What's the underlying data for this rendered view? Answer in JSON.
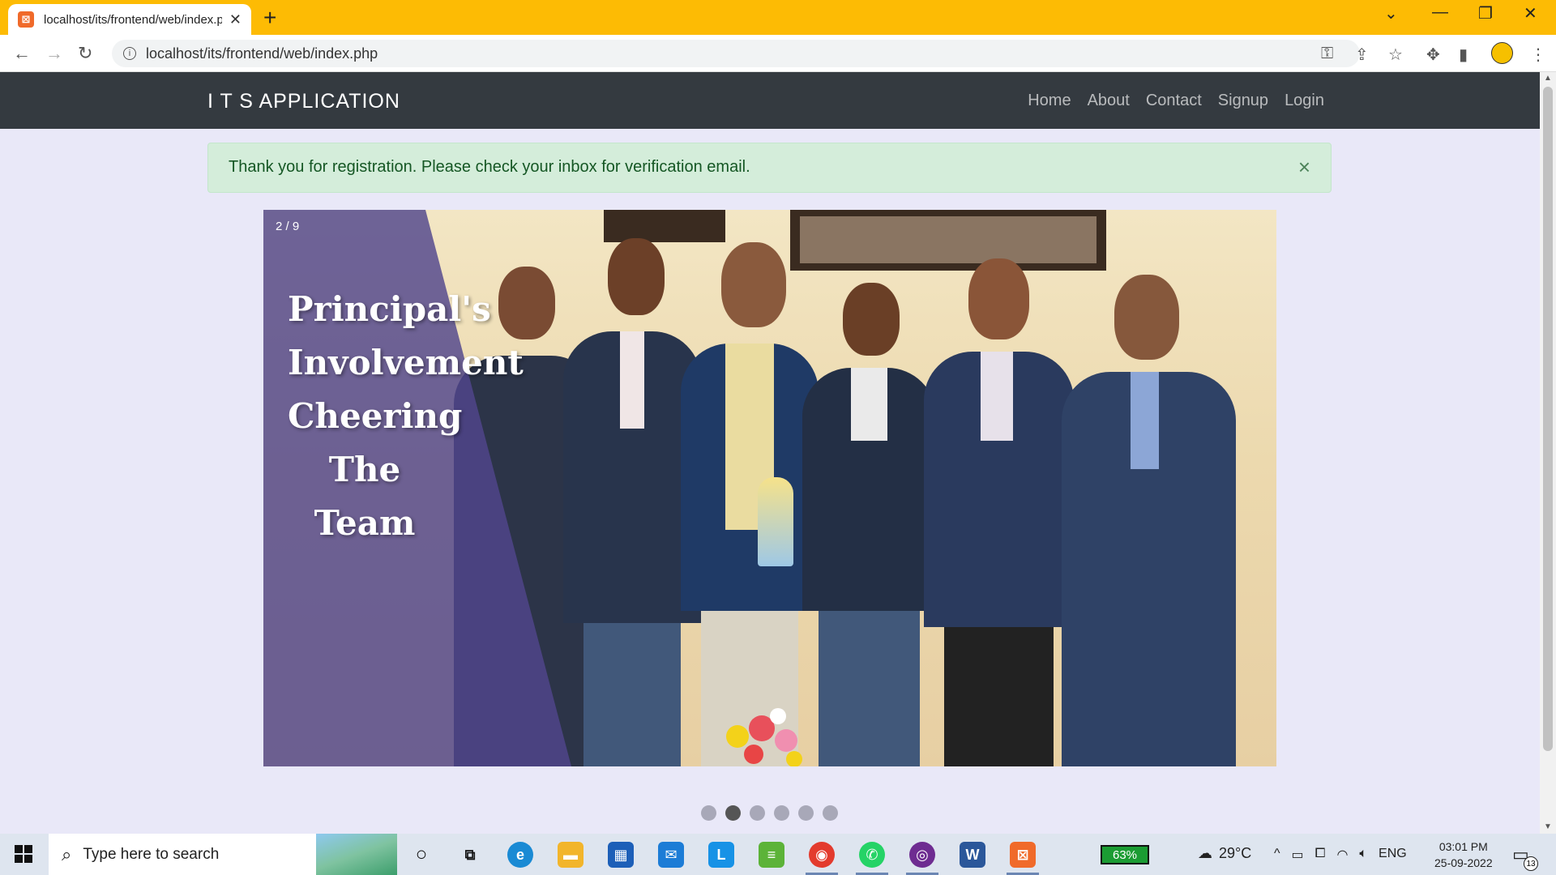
{
  "browser": {
    "tab_title": "localhost/its/frontend/web/index.php",
    "url": "localhost/its/frontend/web/index.php",
    "new_tab_glyph": "+",
    "tab_close_glyph": "✕"
  },
  "navbar": {
    "brand": "I T S APPLICATION",
    "links": [
      "Home",
      "About",
      "Contact",
      "Signup",
      "Login"
    ]
  },
  "alert": {
    "message": "Thank you for registration. Please check your inbox for verification email.",
    "close_glyph": "×",
    "type": "success"
  },
  "carousel": {
    "counter": "2 / 9",
    "headline_lines": [
      "Principal's",
      "Involvement",
      "Cheering",
      "The Team"
    ],
    "dot_count": 6,
    "active_dot": 1
  },
  "taskbar": {
    "search_placeholder": "Type here to search",
    "battery": "63%",
    "temperature": "29°C",
    "language": "ENG",
    "time": "03:01 PM",
    "date": "25-09-2022",
    "notification_count": "13"
  },
  "colors": {
    "tabstrip": "#fdbb04",
    "navbar_bg": "#343a40",
    "page_bg": "#e9e8f8",
    "alert_bg": "#d4edda",
    "alert_text": "#155724"
  }
}
